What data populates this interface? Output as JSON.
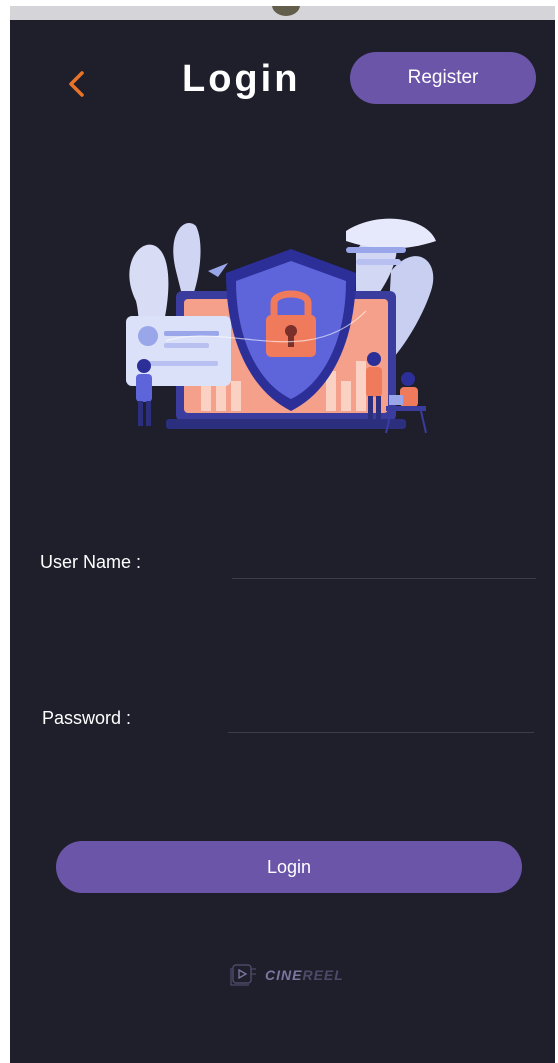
{
  "header": {
    "title": "Login",
    "register_label": "Register"
  },
  "form": {
    "username_label": "User Name :",
    "username_value": "",
    "password_label": "Password :",
    "password_value": "",
    "login_label": "Login"
  },
  "brand": {
    "name_part1": "CINE",
    "name_part2": "REEL"
  },
  "colors": {
    "background": "#1f1e2b",
    "accent_purple": "#6a55a8",
    "back_arrow_orange": "#e8742a"
  },
  "icons": {
    "back": "chevron-left-icon",
    "illustration": "security-shield-lock-illustration",
    "logo": "film-reel-logo-icon"
  }
}
